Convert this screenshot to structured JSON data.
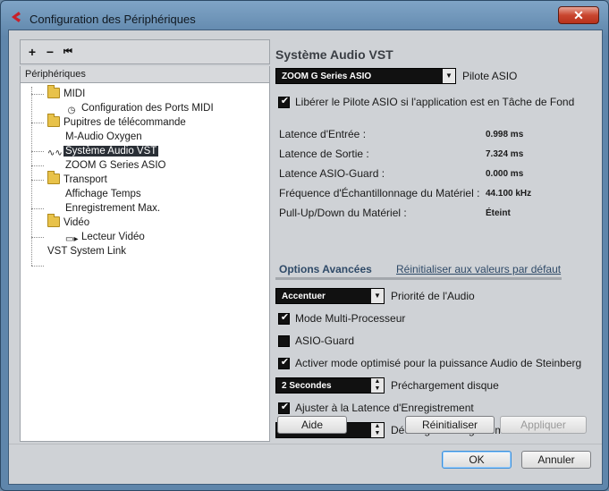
{
  "window": {
    "title": "Configuration des Périphériques",
    "close_label": "✕"
  },
  "toolbar": {
    "add_label": "+",
    "remove_label": "−",
    "reset_label": "⏮"
  },
  "tree": {
    "header": "Périphériques",
    "items": [
      {
        "label": "MIDI",
        "kind": "folder"
      },
      {
        "label": "Configuration des Ports MIDI",
        "kind": "device"
      },
      {
        "label": "Pupitres de télécommande",
        "kind": "folder"
      },
      {
        "label": "M-Audio Oxygen",
        "kind": "device"
      },
      {
        "label": "Système Audio VST",
        "kind": "audio",
        "selected": true
      },
      {
        "label": "ZOOM G Series ASIO",
        "kind": "device"
      },
      {
        "label": "Transport",
        "kind": "folder"
      },
      {
        "label": "Affichage Temps",
        "kind": "device"
      },
      {
        "label": "Enregistrement Max.",
        "kind": "device"
      },
      {
        "label": "Vidéo",
        "kind": "folder"
      },
      {
        "label": "Lecteur Vidéo",
        "kind": "video"
      },
      {
        "label": "VST System Link",
        "kind": "device"
      }
    ]
  },
  "panel": {
    "title": "Système Audio VST",
    "driver_value": "ZOOM G Series ASIO",
    "driver_label": "Pilote ASIO",
    "release_driver_label": "Libérer le Pilote ASIO si l'application est en Tâche de Fond",
    "release_driver_checked": true,
    "info": [
      {
        "label": "Latence d'Entrée :",
        "value": "0.998 ms"
      },
      {
        "label": "Latence de Sortie :",
        "value": "7.324 ms"
      },
      {
        "label": "Latence ASIO-Guard :",
        "value": "0.000 ms"
      },
      {
        "label": "Fréquence d'Échantillonnage du Matériel :",
        "value": "44.100 kHz"
      },
      {
        "label": "Pull-Up/Down du Matériel :",
        "value": "Éteint"
      }
    ],
    "advanced_title": "Options Avancées",
    "advanced_reset_link": "Réinitialiser aux valeurs par défaut",
    "priority_value": "Accentuer",
    "priority_label": "Priorité de l'Audio",
    "multiproc_label": "Mode Multi-Processeur",
    "multiproc_checked": true,
    "asioguard_label": "ASIO-Guard",
    "asioguard_checked": false,
    "steinberg_label": "Activer mode optimisé pour la puissance Audio de Steinberg",
    "steinberg_checked": true,
    "preload_value": "2 Secondes",
    "preload_label": "Préchargement disque",
    "adjust_latency_label": "Ajuster à la Latence d'Enregistrement",
    "adjust_latency_checked": true,
    "offset_value": "0 Échantillons",
    "offset_label": "Décalage d'enregistrement",
    "help_button": "Aide",
    "reset_button": "Réinitialiser",
    "apply_button": "Appliquer"
  },
  "footer": {
    "ok_button": "OK",
    "cancel_button": "Annuler"
  }
}
